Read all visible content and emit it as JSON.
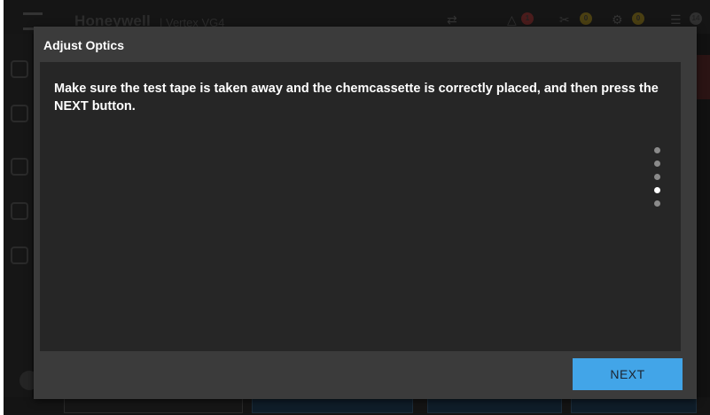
{
  "background": {
    "brand": "Honeywell",
    "model": "| Vertex VG4",
    "badges": [
      "1",
      "0",
      "0",
      "14"
    ]
  },
  "modal": {
    "title": "Adjust Optics",
    "instruction": "Make sure the test tape is taken away and the chemcassette is correctly placed, and then press the NEXT button.",
    "steps": {
      "total": 5,
      "current": 4
    },
    "next_label": "NEXT"
  },
  "colors": {
    "modal_bg": "#3b3b3b",
    "body_bg": "#262626",
    "accent": "#42a5e8",
    "active_dot": "#ffffff",
    "inactive_dot": "#8a8a8a"
  },
  "icons": {
    "menu": "hamburger-menu-icon",
    "alarm": "bell-icon",
    "maintenance": "wrench-icon",
    "faults": "fault-icon",
    "events": "list-icon"
  }
}
